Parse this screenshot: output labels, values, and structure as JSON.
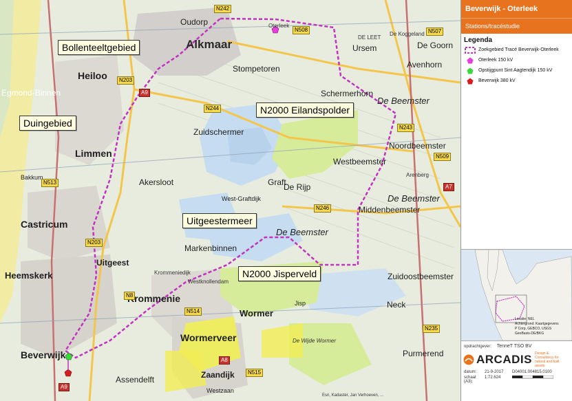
{
  "panel": {
    "title": "Beverwijk - Oterleek",
    "subtitle": "Stations/tracéstudie",
    "legend_title": "Legenda",
    "legend": [
      {
        "label": "Zoekgebied Tracé Beverwijk-Oterleek",
        "symbol": "dashed-purple-outline",
        "color": "#c033c0"
      },
      {
        "label": "Oterleek 150 kV",
        "symbol": "pentagon",
        "color": "#e83be0"
      },
      {
        "label": "Opstijgpunt Sint Aagtendijk 150 kV",
        "symbol": "pentagon",
        "color": "#39d939"
      },
      {
        "label": "Beverwijk 380 kV",
        "symbol": "pentagon",
        "color": "#d71e1e"
      }
    ],
    "inset_credits": [
      "Locatie: NEL",
      "Achtergrond: Kaartgegevens",
      "P Corp, GEBCO, USGS",
      "GeoBasis-DE/BKG"
    ],
    "client_label": "opdrachtgever:",
    "client": "TenneT TSO BV",
    "company": "ARCADIS",
    "company_tagline": "Design & Consultancy for natural and built assets",
    "date_label": "datum:",
    "date": "21-9-2017",
    "scale_label": "schaal (A3):",
    "scale": "1:72.624",
    "project_code": "D04001.004815.0100"
  },
  "callouts": {
    "bollenteelt": "Bollenteeltgebied",
    "duingebied": "Duingebied",
    "eilandspolder": "N2000 Eilandspolder",
    "uitgeestermeer": "Uitgeestermeer",
    "jisperveld": "N2000 Jisperveld"
  },
  "places": {
    "alkmaar": "Alkmaar",
    "heiloo": "Heiloo",
    "limmen": "Limmen",
    "castricum": "Castricum",
    "heemskerk": "Heemskerk",
    "uitgeest": "Uitgeest",
    "krommenie": "Krommenie",
    "beverwijk": "Beverwijk",
    "wormerveer": "Wormerveer",
    "zaandijk": "Zaandijk",
    "oudorp": "Oudorp",
    "oterleek": "Oterleek",
    "ursem": "Ursem",
    "de_goorn": "De Goorn",
    "avenhorn": "Avenhorn",
    "stompetoren": "Stompetoren",
    "schermerhorn": "Schermerhorn",
    "de_beemster_ne": "De Beemster",
    "de_beemster_e": "De Beemster",
    "de_beemster_c": "De Beemster",
    "zuidschermer": "Zuidschermer",
    "noordbeemster": "Noordbeemster",
    "westbeemster": "Westbeemster",
    "middenbeemster": "Middenbeemster",
    "akersloot": "Akersloot",
    "de_rijp": "De Rijp",
    "graft": "Graft",
    "west_graftdijk": "West-Graftdijk",
    "markenbinnen": "Markenbinnen",
    "wormer": "Wormer",
    "jisp": "Jisp",
    "neck": "Neck",
    "zuidoostbeemster": "Zuidoostbeemster",
    "purmerend": "Purmerend",
    "assendelft": "Assendelft",
    "westzaan": "Westzaan",
    "egmond_binnen": "Egmond-Binnen",
    "bakkum": "Bakkum",
    "uitgeesterbroek": "Uitgeest",
    "krommeniedijk": "Krommeniedijk",
    "westknollendam": "Westknollendam",
    "de_wijde_wormer": "De Wijde Wormer",
    "de_leet": "DE LEET",
    "kogge": "De Koggeland",
    "arenberg": "Arenberg"
  },
  "roads": [
    "N242",
    "N508",
    "N507",
    "N203",
    "A9",
    "N244",
    "N243",
    "N509",
    "N513",
    "N246",
    "N203",
    "A7",
    "N514",
    "N8",
    "N515",
    "N235",
    "A8",
    "A9"
  ],
  "colors": {
    "accent": "#e8731f",
    "search_area": "#c033c0",
    "natura2000": "#d7ec9a",
    "water": "#c6dcf0",
    "yellow_zone": "#f1ee54"
  },
  "map_footer": "Esri, Kadaster, Jan Verhoeven, ..."
}
